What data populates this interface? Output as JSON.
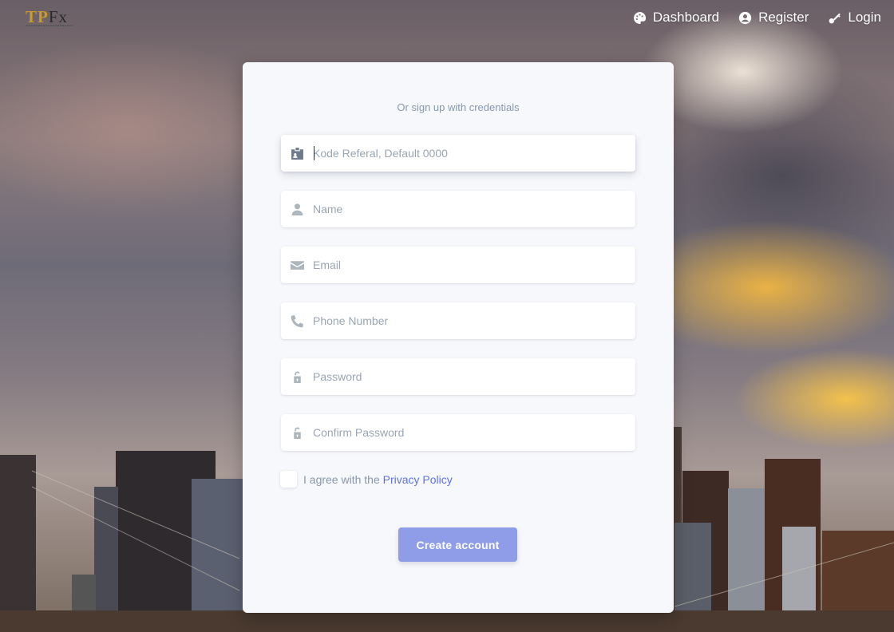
{
  "brand": {
    "mark": "TP",
    "mark2": "Fx"
  },
  "nav": [
    {
      "label": "Dashboard",
      "icon": "palette-icon"
    },
    {
      "label": "Register",
      "icon": "user-circle-icon"
    },
    {
      "label": "Login",
      "icon": "key-icon"
    }
  ],
  "form": {
    "subtitle": "Or sign up with credentials",
    "fields": [
      {
        "placeholder": "Kode Referal, Default 0000",
        "value": "",
        "icon": "badge-icon",
        "focused": true
      },
      {
        "placeholder": "Name",
        "value": "",
        "icon": "user-icon"
      },
      {
        "placeholder": "Email",
        "value": "",
        "icon": "envelope-icon"
      },
      {
        "placeholder": "Phone Number",
        "value": "",
        "icon": "phone-icon"
      },
      {
        "placeholder": "Password",
        "value": "",
        "icon": "lock-open-icon"
      },
      {
        "placeholder": "Confirm Password",
        "value": "",
        "icon": "lock-open-icon"
      }
    ],
    "agree_text": "I agree with the",
    "agree_link": "Privacy Policy",
    "submit_label": "Create account"
  },
  "colors": {
    "primary": "#5e72e4",
    "button": "#8f9ce8",
    "card": "#f6f8fb"
  }
}
